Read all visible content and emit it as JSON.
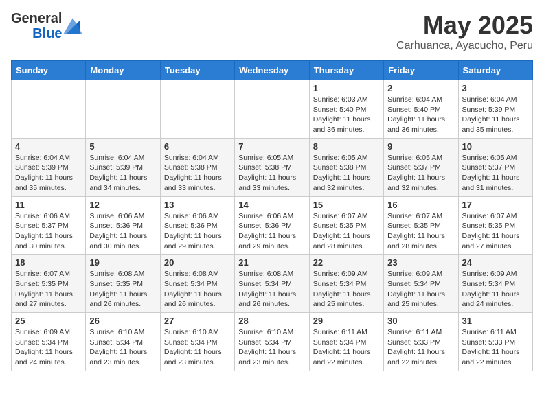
{
  "header": {
    "logo_general": "General",
    "logo_blue": "Blue",
    "month": "May 2025",
    "location": "Carhuanca, Ayacucho, Peru"
  },
  "days_of_week": [
    "Sunday",
    "Monday",
    "Tuesday",
    "Wednesday",
    "Thursday",
    "Friday",
    "Saturday"
  ],
  "weeks": [
    {
      "days": [
        {
          "number": "",
          "info": ""
        },
        {
          "number": "",
          "info": ""
        },
        {
          "number": "",
          "info": ""
        },
        {
          "number": "",
          "info": ""
        },
        {
          "number": "1",
          "info": "Sunrise: 6:03 AM\nSunset: 5:40 PM\nDaylight: 11 hours\nand 36 minutes."
        },
        {
          "number": "2",
          "info": "Sunrise: 6:04 AM\nSunset: 5:40 PM\nDaylight: 11 hours\nand 36 minutes."
        },
        {
          "number": "3",
          "info": "Sunrise: 6:04 AM\nSunset: 5:39 PM\nDaylight: 11 hours\nand 35 minutes."
        }
      ]
    },
    {
      "days": [
        {
          "number": "4",
          "info": "Sunrise: 6:04 AM\nSunset: 5:39 PM\nDaylight: 11 hours\nand 35 minutes."
        },
        {
          "number": "5",
          "info": "Sunrise: 6:04 AM\nSunset: 5:39 PM\nDaylight: 11 hours\nand 34 minutes."
        },
        {
          "number": "6",
          "info": "Sunrise: 6:04 AM\nSunset: 5:38 PM\nDaylight: 11 hours\nand 33 minutes."
        },
        {
          "number": "7",
          "info": "Sunrise: 6:05 AM\nSunset: 5:38 PM\nDaylight: 11 hours\nand 33 minutes."
        },
        {
          "number": "8",
          "info": "Sunrise: 6:05 AM\nSunset: 5:38 PM\nDaylight: 11 hours\nand 32 minutes."
        },
        {
          "number": "9",
          "info": "Sunrise: 6:05 AM\nSunset: 5:37 PM\nDaylight: 11 hours\nand 32 minutes."
        },
        {
          "number": "10",
          "info": "Sunrise: 6:05 AM\nSunset: 5:37 PM\nDaylight: 11 hours\nand 31 minutes."
        }
      ]
    },
    {
      "days": [
        {
          "number": "11",
          "info": "Sunrise: 6:06 AM\nSunset: 5:37 PM\nDaylight: 11 hours\nand 30 minutes."
        },
        {
          "number": "12",
          "info": "Sunrise: 6:06 AM\nSunset: 5:36 PM\nDaylight: 11 hours\nand 30 minutes."
        },
        {
          "number": "13",
          "info": "Sunrise: 6:06 AM\nSunset: 5:36 PM\nDaylight: 11 hours\nand 29 minutes."
        },
        {
          "number": "14",
          "info": "Sunrise: 6:06 AM\nSunset: 5:36 PM\nDaylight: 11 hours\nand 29 minutes."
        },
        {
          "number": "15",
          "info": "Sunrise: 6:07 AM\nSunset: 5:35 PM\nDaylight: 11 hours\nand 28 minutes."
        },
        {
          "number": "16",
          "info": "Sunrise: 6:07 AM\nSunset: 5:35 PM\nDaylight: 11 hours\nand 28 minutes."
        },
        {
          "number": "17",
          "info": "Sunrise: 6:07 AM\nSunset: 5:35 PM\nDaylight: 11 hours\nand 27 minutes."
        }
      ]
    },
    {
      "days": [
        {
          "number": "18",
          "info": "Sunrise: 6:07 AM\nSunset: 5:35 PM\nDaylight: 11 hours\nand 27 minutes."
        },
        {
          "number": "19",
          "info": "Sunrise: 6:08 AM\nSunset: 5:35 PM\nDaylight: 11 hours\nand 26 minutes."
        },
        {
          "number": "20",
          "info": "Sunrise: 6:08 AM\nSunset: 5:34 PM\nDaylight: 11 hours\nand 26 minutes."
        },
        {
          "number": "21",
          "info": "Sunrise: 6:08 AM\nSunset: 5:34 PM\nDaylight: 11 hours\nand 26 minutes."
        },
        {
          "number": "22",
          "info": "Sunrise: 6:09 AM\nSunset: 5:34 PM\nDaylight: 11 hours\nand 25 minutes."
        },
        {
          "number": "23",
          "info": "Sunrise: 6:09 AM\nSunset: 5:34 PM\nDaylight: 11 hours\nand 25 minutes."
        },
        {
          "number": "24",
          "info": "Sunrise: 6:09 AM\nSunset: 5:34 PM\nDaylight: 11 hours\nand 24 minutes."
        }
      ]
    },
    {
      "days": [
        {
          "number": "25",
          "info": "Sunrise: 6:09 AM\nSunset: 5:34 PM\nDaylight: 11 hours\nand 24 minutes."
        },
        {
          "number": "26",
          "info": "Sunrise: 6:10 AM\nSunset: 5:34 PM\nDaylight: 11 hours\nand 23 minutes."
        },
        {
          "number": "27",
          "info": "Sunrise: 6:10 AM\nSunset: 5:34 PM\nDaylight: 11 hours\nand 23 minutes."
        },
        {
          "number": "28",
          "info": "Sunrise: 6:10 AM\nSunset: 5:34 PM\nDaylight: 11 hours\nand 23 minutes."
        },
        {
          "number": "29",
          "info": "Sunrise: 6:11 AM\nSunset: 5:34 PM\nDaylight: 11 hours\nand 22 minutes."
        },
        {
          "number": "30",
          "info": "Sunrise: 6:11 AM\nSunset: 5:33 PM\nDaylight: 11 hours\nand 22 minutes."
        },
        {
          "number": "31",
          "info": "Sunrise: 6:11 AM\nSunset: 5:33 PM\nDaylight: 11 hours\nand 22 minutes."
        }
      ]
    }
  ]
}
